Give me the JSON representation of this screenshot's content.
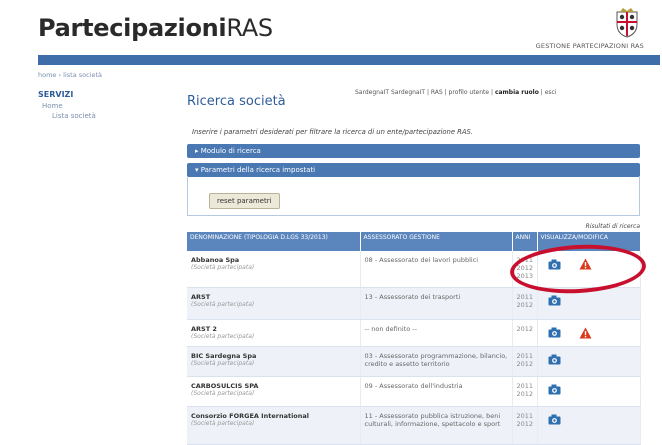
{
  "header": {
    "logo_bold": "Partecipazioni",
    "logo_light": "RAS",
    "emblem_caption": "GESTIONE PARTECIPAZIONI RAS"
  },
  "breadcrumb": "home › lista società",
  "sidebar": {
    "title": "SERVIZI",
    "items": [
      {
        "label": "Home"
      },
      {
        "label": "Lista società"
      }
    ]
  },
  "userbar": {
    "links": "SardegnaIT  SardegnaIT | RAS | profilo utente |",
    "change_role": "cambia ruolo",
    "exit": "| esci"
  },
  "page": {
    "title": "Ricerca società",
    "intro": "Inserire i parametri desiderati per filtrare la ricerca di un ente/partecipazione RAS."
  },
  "accordion": {
    "search_form": "▸ Modulo di ricerca",
    "params_set": "▾ Parametri della ricerca impostati",
    "reset_label": "reset parametri"
  },
  "results": {
    "label": "Risultati di ricerca",
    "headers": [
      "DENOMINAZIONE (TIPOLOGIA D.LGS 33/2013)",
      "ASSESSORATO GESTIONE",
      "ANNI",
      "VISUALIZZA/MODIFICA"
    ],
    "rows": [
      {
        "name": "Abbanoa Spa",
        "type": "(Società partecipata)",
        "assessorato": "08 - Assessorato dei lavori pubblici",
        "years": "2011\n2012\n2013",
        "warn": true
      },
      {
        "name": "ARST",
        "type": "(Società partecipata)",
        "assessorato": "13 - Assessorato dei trasporti",
        "years": "2011\n2012",
        "warn": false
      },
      {
        "name": "ARST 2",
        "type": "(Società partecipata)",
        "assessorato": "-- non definito --",
        "years": "2012",
        "warn": true
      },
      {
        "name": "BIC Sardegna Spa",
        "type": "(Società partecipata)",
        "assessorato": "03 - Assessorato programmazione, bilancio, credito e assetto territorio",
        "years": "2011\n2012",
        "warn": false
      },
      {
        "name": "CARBOSULCIS SPA",
        "type": "(Società partecipata)",
        "assessorato": "09 - Assessorato dell'industria",
        "years": "2011\n2012",
        "warn": false
      },
      {
        "name": "Consorzio FORGEA International",
        "type": "(Società partecipata)",
        "assessorato": "11 - Assessorato pubblica istruzione, beni culturali, informazione, spettacolo e sport",
        "years": "2011\n2012",
        "warn": false
      }
    ]
  },
  "colors": {
    "brand_blue": "#3e6da9",
    "warning_red": "#d93a1b",
    "annotation_red": "#c8102e"
  }
}
